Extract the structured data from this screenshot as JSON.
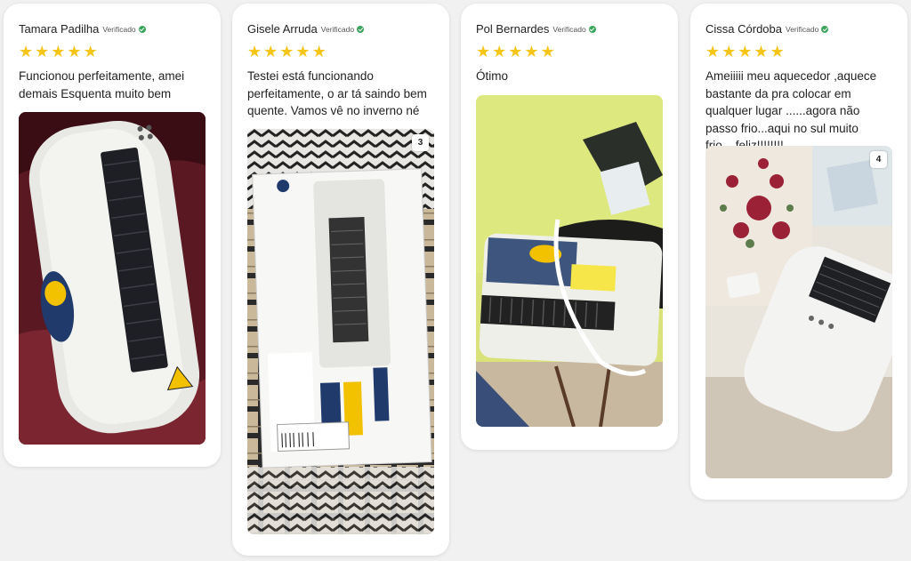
{
  "reviews": [
    {
      "name": "Tamara Padilha",
      "verified_label": "Verificado",
      "rating": 5,
      "text": "Funcionou perfeitamente, amei demais Esquenta muito bem",
      "photo_badge": "",
      "photo_icon": "heater-photo"
    },
    {
      "name": "Gisele Arruda",
      "verified_label": "Verificado",
      "rating": 5,
      "text": "Testei está funcionando perfeitamente, o ar tá saindo bem quente. Vamos vê no inverno né",
      "photo_badge": "3",
      "photo_icon": "heater-box-photo"
    },
    {
      "name": "Pol Bernardes",
      "verified_label": "Verificado",
      "rating": 5,
      "text": "Ótimo",
      "photo_badge": "",
      "photo_icon": "heater-photo"
    },
    {
      "name": "Cissa Córdoba",
      "verified_label": "Verificado",
      "rating": 5,
      "text": "Ameiiiii meu aquecedor ,aquece bastante da pra colocar em qualquer lugar ......agora não passo frio...aqui no sul muito frio....feliz!!!!!!!!",
      "photo_badge": "4",
      "photo_icon": "heater-photo"
    }
  ],
  "colors": {
    "star": "#f5c518",
    "verified_check": "#3ba55c",
    "card_bg": "#ffffff",
    "page_bg": "#f1f1f1"
  }
}
